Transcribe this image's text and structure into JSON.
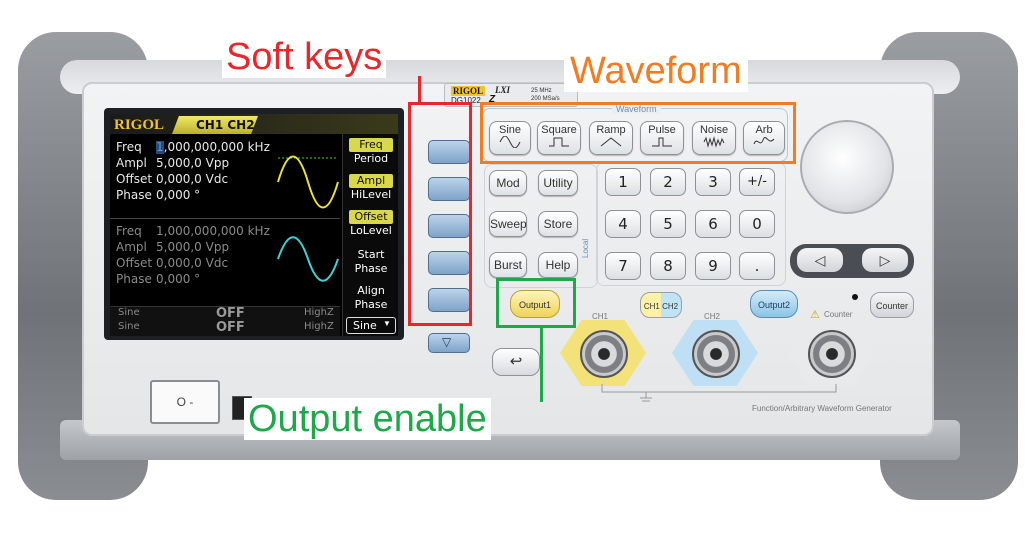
{
  "annotations": {
    "soft_keys": "Soft keys",
    "waveform": "Waveform",
    "output_enable": "Output enable",
    "colors": {
      "red": "#e8262b",
      "orange": "#f47c20",
      "green": "#1ea84a"
    }
  },
  "device": {
    "brand": "RIGOL",
    "model": "DG1022",
    "model_suffix": "Z",
    "spec_line1": "25 MHz",
    "spec_line2": "200 MSa/s",
    "lxi": "LXI",
    "footer": "Function/Arbitrary Waveform Generator"
  },
  "screen": {
    "brand": "RIGOL",
    "channels": "CH1 CH2",
    "ch1": {
      "freq_label": "Freq",
      "freq_value": "1,000,000,000 kHz",
      "ampl_label": "Ampl",
      "ampl_value": "5,000,0 Vpp",
      "offset_label": "Offset",
      "offset_value": "0,000,0 Vdc",
      "phase_label": "Phase",
      "phase_value": "0,000 °"
    },
    "ch2": {
      "freq_label": "Freq",
      "freq_value": "1,000,000,000 kHz",
      "ampl_label": "Ampl",
      "ampl_value": "5,000,0 Vpp",
      "offset_label": "Offset",
      "offset_value": "0,000,0 Vdc",
      "phase_label": "Phase",
      "phase_value": "0,000 °"
    },
    "status": {
      "wave1": "Sine",
      "wave2": "Sine",
      "out1": "OFF",
      "out2": "OFF",
      "load1": "HighZ",
      "load2": "HighZ"
    },
    "softkey_labels": [
      {
        "top": "Freq",
        "bottom": "Period"
      },
      {
        "top": "Ampl",
        "bottom": "HiLevel"
      },
      {
        "top": "Offset",
        "bottom": "LoLevel"
      },
      {
        "top": "Start",
        "bottom": "Phase"
      },
      {
        "top": "Align",
        "bottom": "Phase"
      }
    ],
    "dropdown": "Sine"
  },
  "waveform_group": {
    "title": "Waveform",
    "keys": [
      "Sine",
      "Square",
      "Ramp",
      "Pulse",
      "Noise",
      "Arb"
    ]
  },
  "function_keys": [
    "Mod",
    "Utility",
    "Sweep",
    "Store",
    "Burst",
    "Help"
  ],
  "local_label": "Local",
  "numpad": [
    "1",
    "2",
    "3",
    "+/-",
    "4",
    "5",
    "6",
    "0",
    "7",
    "8",
    "9",
    "."
  ],
  "outputs": {
    "output1": "Output1",
    "ch1ch2": "CH1 CH2",
    "output2": "Output2",
    "counter": "Counter",
    "counter_label": "Counter",
    "ch1_label": "CH1",
    "ch2_label": "CH2"
  },
  "power": {
    "symbol": "O -"
  }
}
